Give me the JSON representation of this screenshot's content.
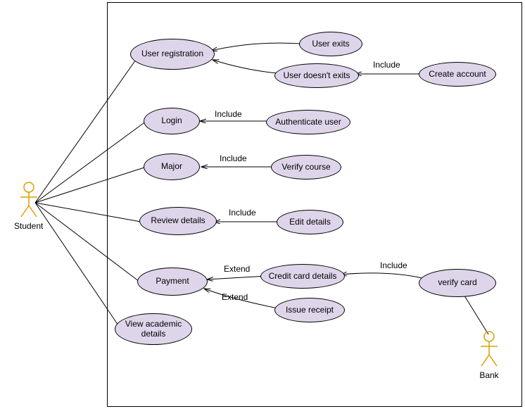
{
  "actors": {
    "student": "Student",
    "bank": "Bank"
  },
  "usecases": {
    "user_registration": "User registration",
    "user_exits": "User exits",
    "user_doesnt_exits": "User doesn't exits",
    "create_account": "Create account",
    "login": "Login",
    "authenticate_user": "Authenticate user",
    "major": "Major",
    "verify_course": "Verify course",
    "review_details": "Review details",
    "edit_details": "Edit details",
    "payment": "Payment",
    "credit_card_details": "Credit card details",
    "verify_card": "verify card",
    "issue_receipt": "Issue receipt",
    "view_academic_details": "View academic details"
  },
  "labels": {
    "include1": "Include",
    "include2": "Include",
    "include3": "Include",
    "include4": "Include",
    "include5": "Include",
    "extend1": "Extend",
    "extend2": "Extend"
  },
  "chart_data": {
    "type": "diagram",
    "diagram_type": "UML Use Case Diagram",
    "title": "",
    "actors": [
      {
        "name": "Student",
        "position": "left"
      },
      {
        "name": "Bank",
        "position": "right"
      }
    ],
    "use_cases": [
      "User registration",
      "User exits",
      "User doesn't exits",
      "Create account",
      "Login",
      "Authenticate user",
      "Major",
      "Verify course",
      "Review details",
      "Edit details",
      "Payment",
      "Credit card details",
      "verify card",
      "Issue receipt",
      "View academic details"
    ],
    "associations": [
      {
        "actor": "Student",
        "usecase": "User registration"
      },
      {
        "actor": "Student",
        "usecase": "Login"
      },
      {
        "actor": "Student",
        "usecase": "Major"
      },
      {
        "actor": "Student",
        "usecase": "Review details"
      },
      {
        "actor": "Student",
        "usecase": "Payment"
      },
      {
        "actor": "Student",
        "usecase": "View academic details"
      },
      {
        "actor": "Bank",
        "usecase": "verify card"
      }
    ],
    "relations": [
      {
        "from": "User exits",
        "to": "User registration",
        "stereotype": ""
      },
      {
        "from": "User doesn't exits",
        "to": "User registration",
        "stereotype": ""
      },
      {
        "from": "Create account",
        "to": "User doesn't exits",
        "stereotype": "Include"
      },
      {
        "from": "Authenticate user",
        "to": "Login",
        "stereotype": "Include"
      },
      {
        "from": "Verify course",
        "to": "Major",
        "stereotype": "Include"
      },
      {
        "from": "Edit details",
        "to": "Review details",
        "stereotype": "Include"
      },
      {
        "from": "Credit card details",
        "to": "Payment",
        "stereotype": "Extend"
      },
      {
        "from": "Issue receipt",
        "to": "Payment",
        "stereotype": "Extend"
      },
      {
        "from": "verify card",
        "to": "Credit card details",
        "stereotype": "Include"
      }
    ]
  }
}
